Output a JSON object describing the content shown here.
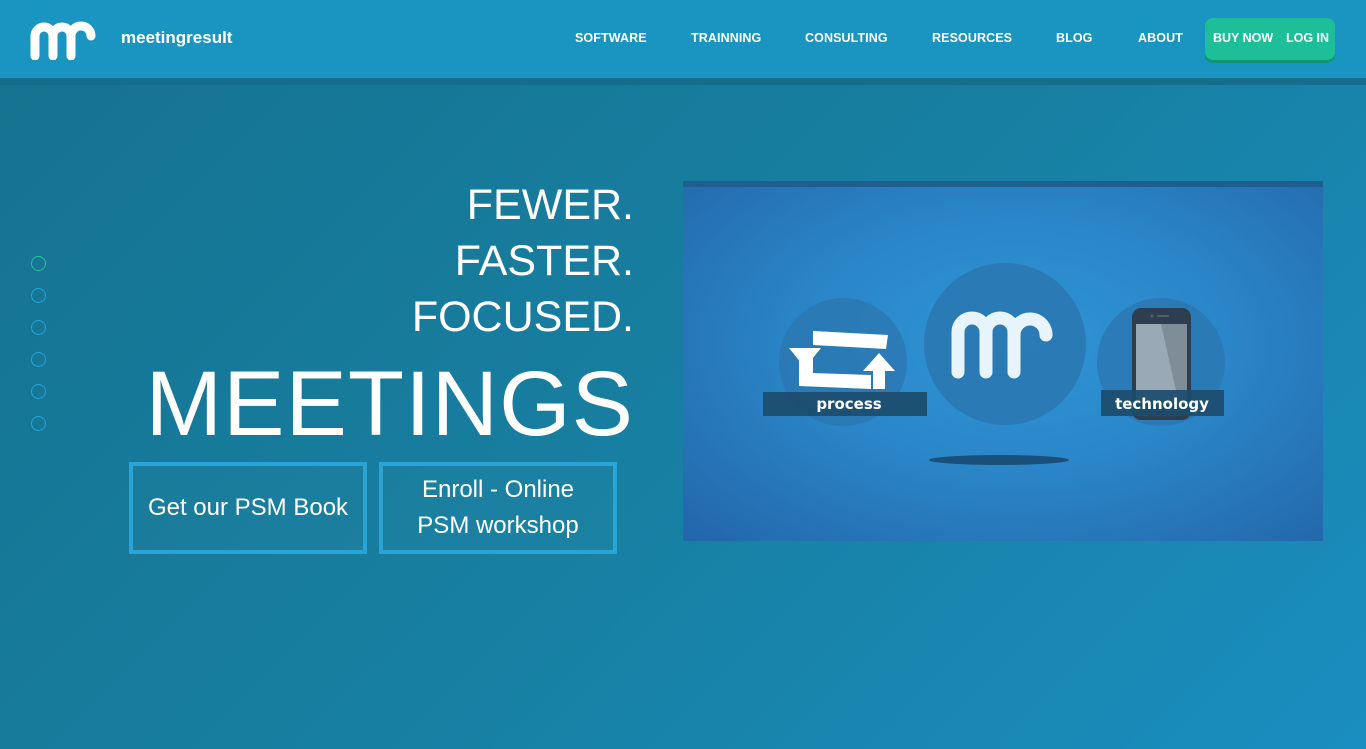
{
  "header": {
    "brand": "meetingresult",
    "nav": [
      "SOFTWARE",
      "TRAINNING",
      "CONSULTING",
      "RESOURCES",
      "BLOG",
      "ABOUT"
    ],
    "buy_now": "BUY NOW",
    "log_in": "LOG IN"
  },
  "hero": {
    "line1": "FEWER.",
    "line2": "FASTER.",
    "line3": "FOCUSED.",
    "headline": "MEETINGS",
    "btn_book": "Get our PSM Book",
    "btn_enroll": "Enroll - Online PSM workshop"
  },
  "slider": {
    "dot_count": 6,
    "active_index": 0
  },
  "video": {
    "label_process": "process",
    "label_technology": "technology"
  },
  "colors": {
    "header": "#1a94c1",
    "accent_green": "#1dbf98",
    "button_border": "#2aa3d6",
    "background": "#1780a3"
  },
  "icons": [
    "mr-logo-icon",
    "sync-arrows-icon",
    "smartphone-icon"
  ]
}
